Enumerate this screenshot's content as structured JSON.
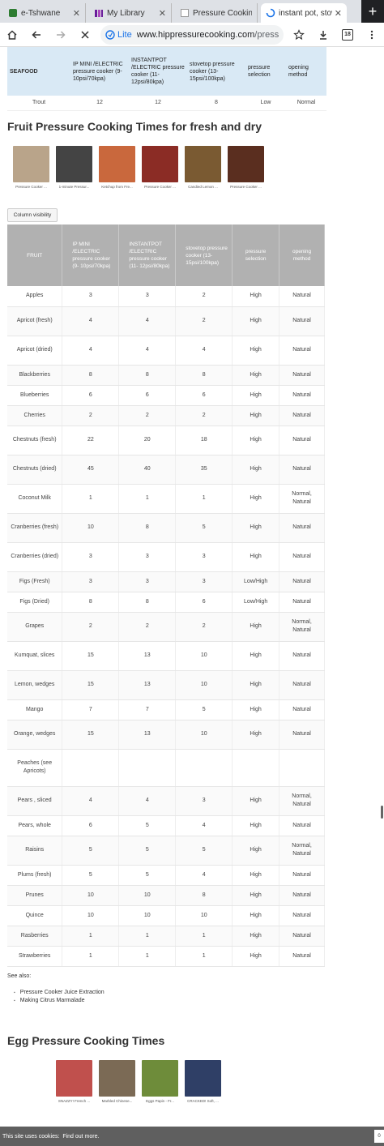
{
  "browser": {
    "tabs": [
      {
        "title": "e-Tshwane",
        "icon": "page-icon",
        "color": "#2e7d32"
      },
      {
        "title": "My Library",
        "icon": "library-icon",
        "color": "#6a1b9a"
      },
      {
        "title": "Pressure Cookin",
        "icon": "page-icon",
        "color": "#e0e0e0"
      },
      {
        "title": "instant pot, stov",
        "icon": "loading-icon",
        "color": "#1a73e8"
      }
    ],
    "new_tab": "+",
    "omnibox": {
      "lite": "Lite",
      "host": "www.hippressurecooking.com",
      "path": "/pressure-co"
    },
    "tab_count": "18"
  },
  "seafood_table": {
    "headers": [
      "SEAFOOD",
      "IP MINI /ELECTRIC pressure cooker (9-10psi/70kpa)",
      "INSTANTPOT /ELECTRIC pressure cooker (11-12psi/80kpa)",
      "stovetop pressure cooker (13-15psi/100kpa)",
      "pressure selection",
      "opening method"
    ],
    "row": [
      "Trout",
      "12",
      "12",
      "8",
      "Low",
      "Normal"
    ]
  },
  "fruit_section": {
    "heading": "Fruit Pressure Cooking Times for fresh and dry",
    "thumbs": [
      {
        "caption": "Pressure Cooker ...",
        "color": "#b9a48a"
      },
      {
        "caption": "1-minute Pressur...",
        "color": "#444444"
      },
      {
        "caption": "Ketchup from Fre...",
        "color": "#c9683d"
      },
      {
        "caption": "Pressure Cooker ...",
        "color": "#8b2c25"
      },
      {
        "caption": "Candied Lemon ...",
        "color": "#7a5a32"
      },
      {
        "caption": "Pressure Cooker ...",
        "color": "#5a2e1f"
      }
    ],
    "column_visibility": "Column visibility"
  },
  "fruit_table": {
    "headers": [
      "FRUIT",
      "IP MINI /ELECTRIC pressure cooker (9- 10psi/70kpa)",
      "INSTANTPOT /ELECTRIC pressure cooker (11- 12psi/80kpa)",
      "stovetop pressure cooker (13- 15psi/100kpa)",
      "pressure selection",
      "opening method"
    ],
    "rows": [
      [
        "Apples",
        "3",
        "3",
        "2",
        "High",
        "Natural"
      ],
      [
        "Apricot (fresh)",
        "4",
        "4",
        "2",
        "High",
        "Natural"
      ],
      [
        "Apricot (dried)",
        "4",
        "4",
        "4",
        "High",
        "Natural"
      ],
      [
        "Blackberries",
        "8",
        "8",
        "8",
        "High",
        "Natural"
      ],
      [
        "Blueberries",
        "6",
        "6",
        "6",
        "High",
        "Natural"
      ],
      [
        "Cherries",
        "2",
        "2",
        "2",
        "High",
        "Natural"
      ],
      [
        "Chestnuts (fresh)",
        "22",
        "20",
        "18",
        "High",
        "Natural"
      ],
      [
        "Chestnuts (dried)",
        "45",
        "40",
        "35",
        "High",
        "Natural"
      ],
      [
        "Coconut Milk",
        "1",
        "1",
        "1",
        "High",
        "Normal, Natural"
      ],
      [
        "Cranberries (fresh)",
        "10",
        "8",
        "5",
        "High",
        "Natural"
      ],
      [
        "Cranberries (dried)",
        "3",
        "3",
        "3",
        "High",
        "Natural"
      ],
      [
        "Figs (Fresh)",
        "3",
        "3",
        "3",
        "Low/High",
        "Natural"
      ],
      [
        "Figs (Dried)",
        "8",
        "8",
        "6",
        "Low/High",
        "Natural"
      ],
      [
        "Grapes",
        "2",
        "2",
        "2",
        "High",
        "Normal, Natural"
      ],
      [
        "Kumquat, slices",
        "15",
        "13",
        "10",
        "High",
        "Natural"
      ],
      [
        "Lemon, wedges",
        "15",
        "13",
        "10",
        "High",
        "Natural"
      ],
      [
        "Mango",
        "7",
        "7",
        "5",
        "High",
        "Natural"
      ],
      [
        "Orange, wedges",
        "15",
        "13",
        "10",
        "High",
        "Natural"
      ],
      [
        "Peaches (see Apricots)",
        "",
        "",
        "",
        "",
        ""
      ],
      [
        "Pears , sliced",
        "4",
        "4",
        "3",
        "High",
        "Normal, Natural"
      ],
      [
        "Pears, whole",
        "6",
        "5",
        "4",
        "High",
        "Natural"
      ],
      [
        "Raisins",
        "5",
        "5",
        "5",
        "High",
        "Normal, Natural"
      ],
      [
        "Plums (fresh)",
        "5",
        "5",
        "4",
        "High",
        "Natural"
      ],
      [
        "Prunes",
        "10",
        "10",
        "8",
        "High",
        "Natural"
      ],
      [
        "Quince",
        "10",
        "10",
        "10",
        "High",
        "Natural"
      ],
      [
        "Rasberries",
        "1",
        "1",
        "1",
        "High",
        "Natural"
      ],
      [
        "Strawberries",
        "1",
        "1",
        "1",
        "High",
        "Natural"
      ]
    ]
  },
  "see_also": {
    "label": "See also:",
    "links": [
      "Pressure Cooker Juice Extraction",
      "Making Citrus Marmalade"
    ]
  },
  "egg_section": {
    "heading": "Egg Pressure Cooking Times",
    "thumbs": [
      {
        "caption": "SNAZZY! French ...",
        "color": "#c0504d"
      },
      {
        "caption": "Marbled Chinese...",
        "color": "#7b6a55"
      },
      {
        "caption": "Eggs Papin - Fr...",
        "color": "#6e8c3a"
      },
      {
        "caption": "CRACKED! Soft, ...",
        "color": "#2f3f66"
      }
    ]
  },
  "cookie_bar": {
    "text": "This site uses cookies:",
    "link": "Find out more.",
    "ok": "0"
  }
}
